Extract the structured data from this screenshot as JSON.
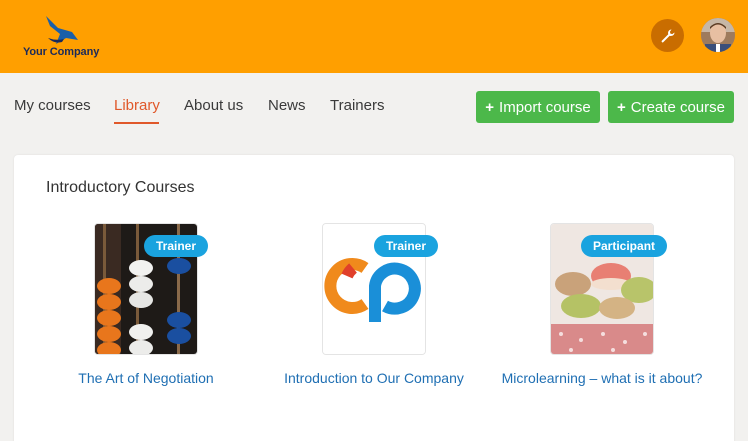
{
  "header": {
    "logo_text": "Your Company",
    "settings_icon": "wrench-icon",
    "avatar_icon": "user-avatar"
  },
  "nav": {
    "items": [
      {
        "label": "My courses",
        "active": false
      },
      {
        "label": "Library",
        "active": true
      },
      {
        "label": "About us",
        "active": false
      },
      {
        "label": "News",
        "active": false
      },
      {
        "label": "Trainers",
        "active": false
      }
    ]
  },
  "actions": {
    "import_label": "Import course",
    "create_label": "Create course",
    "plus_icon": "+"
  },
  "section": {
    "title": "Introductory Courses",
    "courses": [
      {
        "title": "The Art of Negotiation",
        "badge": "Trainer",
        "thumb": "abacus-image"
      },
      {
        "title": "Introduction to Our Company",
        "badge": "Trainer",
        "thumb": "cp-logo-image"
      },
      {
        "title": "Microlearning – what is it about?",
        "badge": "Participant",
        "thumb": "macarons-image"
      }
    ]
  },
  "colors": {
    "header": "#ff9f00",
    "accent": "#e0582a",
    "button": "#4cb84a",
    "badge": "#1aa3df",
    "link": "#1f6fb3"
  }
}
